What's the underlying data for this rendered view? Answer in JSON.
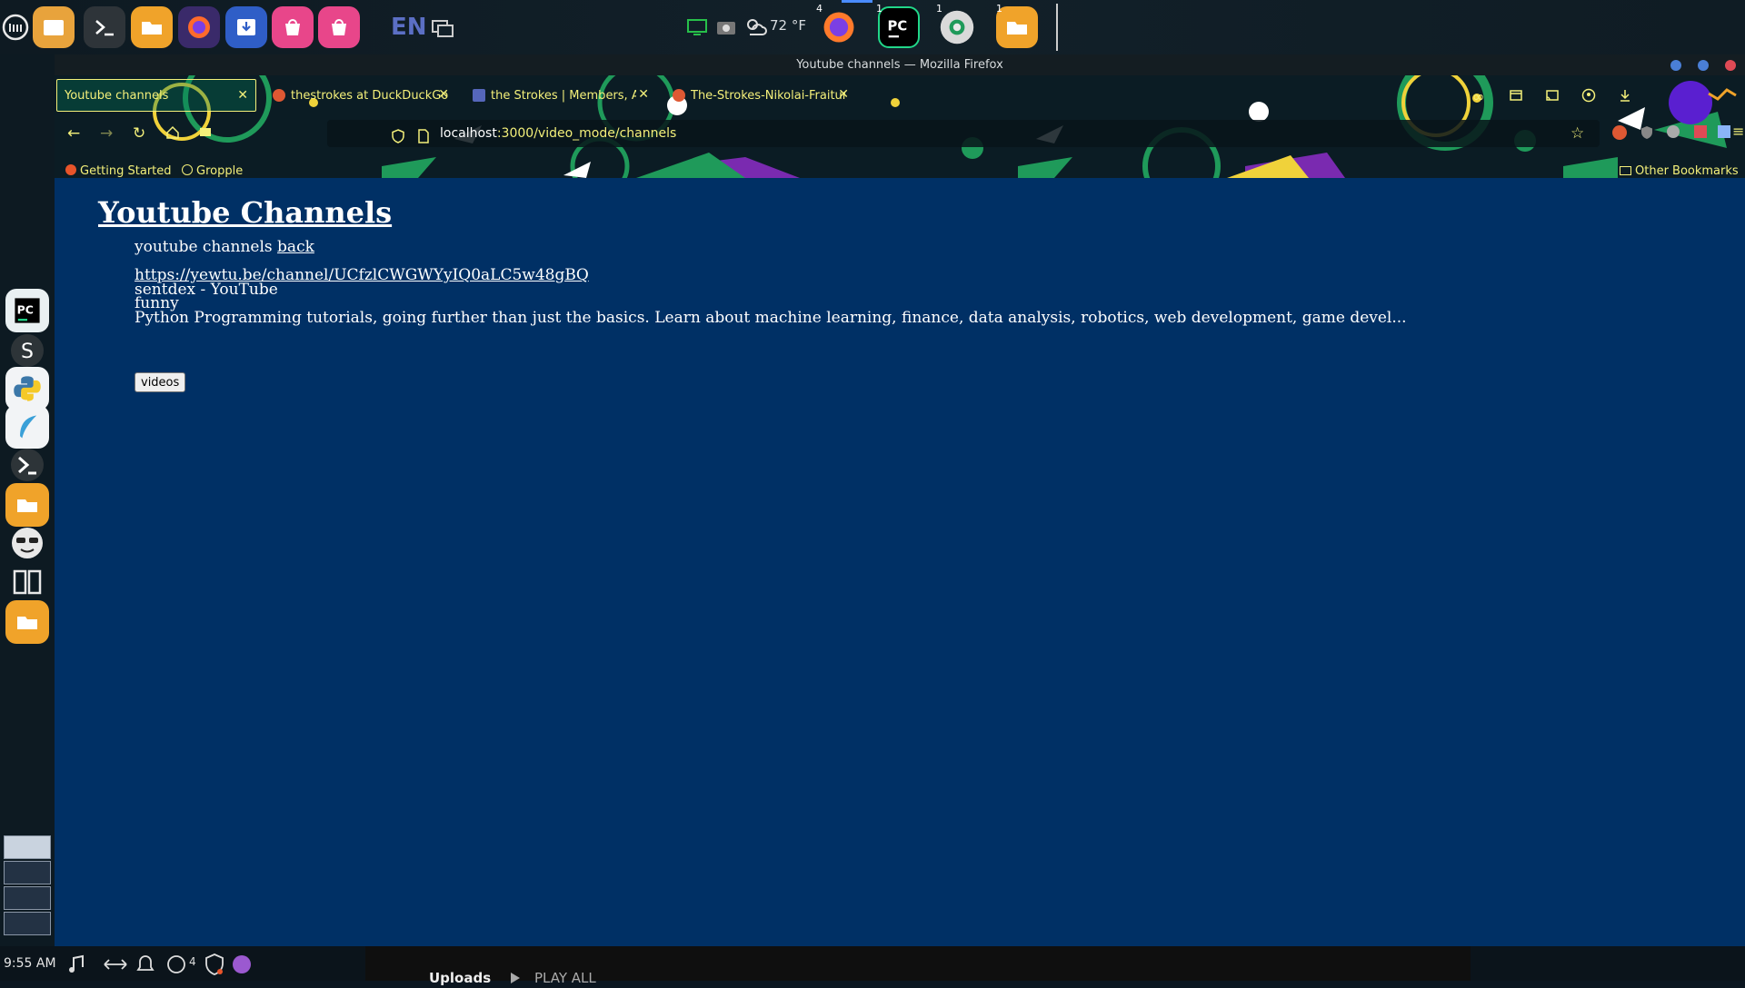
{
  "top_panel": {
    "language": "EN",
    "temperature": "72 °F",
    "badges": [
      "4",
      "1",
      "1",
      "1"
    ],
    "icons": [
      "mint-menu-icon",
      "files-icon",
      "terminal-icon",
      "folder-icon",
      "firefox-icon",
      "downloader-icon",
      "store-icon",
      "store-icon",
      "window-switch-icon",
      "monitor-icon",
      "screenshot-icon",
      "weather-icon",
      "firefox-icon",
      "pycharm-icon",
      "settings-icon",
      "folder-icon"
    ]
  },
  "dock": {
    "icons": [
      "pycharm-icon",
      "s-icon",
      "python-icon",
      "feather-icon",
      "terminal-icon",
      "folder-icon",
      "sunglasses-icon",
      "book-icon",
      "folder-icon"
    ]
  },
  "bottom_panel": {
    "clock": "9:55 AM",
    "badge": "4",
    "uploads": "Uploads",
    "play_all": "PLAY ALL"
  },
  "browser": {
    "window_title": "Youtube channels — Mozilla Firefox",
    "tabs": [
      {
        "label": "Youtube channels",
        "active": true
      },
      {
        "label": "thestrokes at DuckDuckGo",
        "active": false
      },
      {
        "label": "the Strokes | Members, Alb",
        "active": false
      },
      {
        "label": "The-Strokes-Nikolai-Fraiture",
        "active": false
      }
    ],
    "url_host": "localhost",
    "url_rest": ":3000/video_mode/channels",
    "bookmarks": [
      "Getting Started",
      "Gropple"
    ],
    "other_bookmarks": "Other Bookmarks"
  },
  "page": {
    "heading": "Youtube Channels",
    "intro_text": "youtube channels",
    "back_link": "back",
    "channel_url": "https://yewtu.be/channel/UCfzlCWGWYyIQ0aLC5w48gBQ",
    "channel_name": "sentdex - YouTube",
    "category": "funny",
    "description": "Python Programming tutorials, going further than just the basics. Learn about machine learning, finance, data analysis, robotics, web development, game devel...",
    "videos_button": "videos"
  },
  "colors": {
    "page_bg": "#003065",
    "toolbar_text": "#f4f07a",
    "decor_green": "#1f9a5a",
    "decor_purple": "#7a2ab0"
  }
}
